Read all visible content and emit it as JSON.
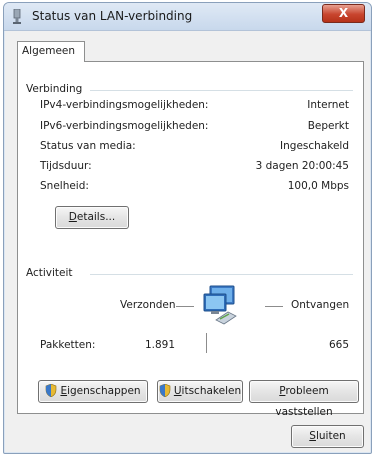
{
  "window": {
    "title": "Status van LAN-verbinding",
    "close_label": "X"
  },
  "tabs": [
    {
      "label": "Algemeen",
      "active": true
    }
  ],
  "connection": {
    "group_title": "Verbinding",
    "rows": [
      {
        "label": "IPv4-verbindingsmogelijkheden:",
        "value": "Internet"
      },
      {
        "label": "IPv6-verbindingsmogelijkheden:",
        "value": "Beperkt"
      },
      {
        "label": "Status van media:",
        "value": "Ingeschakeld"
      },
      {
        "label": "Tijdsduur:",
        "value": "3 dagen 20:00:45"
      },
      {
        "label": "Snelheid:",
        "value": "100,0 Mbps"
      }
    ],
    "details_button": {
      "accel": "D",
      "rest": "etails..."
    }
  },
  "activity": {
    "group_title": "Activiteit",
    "sent_label": "Verzonden",
    "received_label": "Ontvangen",
    "packets_label": "Pakketten:",
    "packets_sent": "1.891",
    "packets_received": "665",
    "icon": "network-computers-icon"
  },
  "buttons": {
    "properties": {
      "accel": "E",
      "rest": "igenschappen",
      "icon": "shield-icon"
    },
    "disable": {
      "accel": "U",
      "rest": "itschakelen",
      "icon": "shield-icon"
    },
    "diagnose": {
      "accel": "P",
      "rest": "robleem vaststellen"
    },
    "close": {
      "accel": "S",
      "rest": "luiten"
    }
  },
  "colors": {
    "close_button": "#c8452e",
    "titlebar": "#dfe9f5",
    "panel_border": "#8e8f8f"
  }
}
